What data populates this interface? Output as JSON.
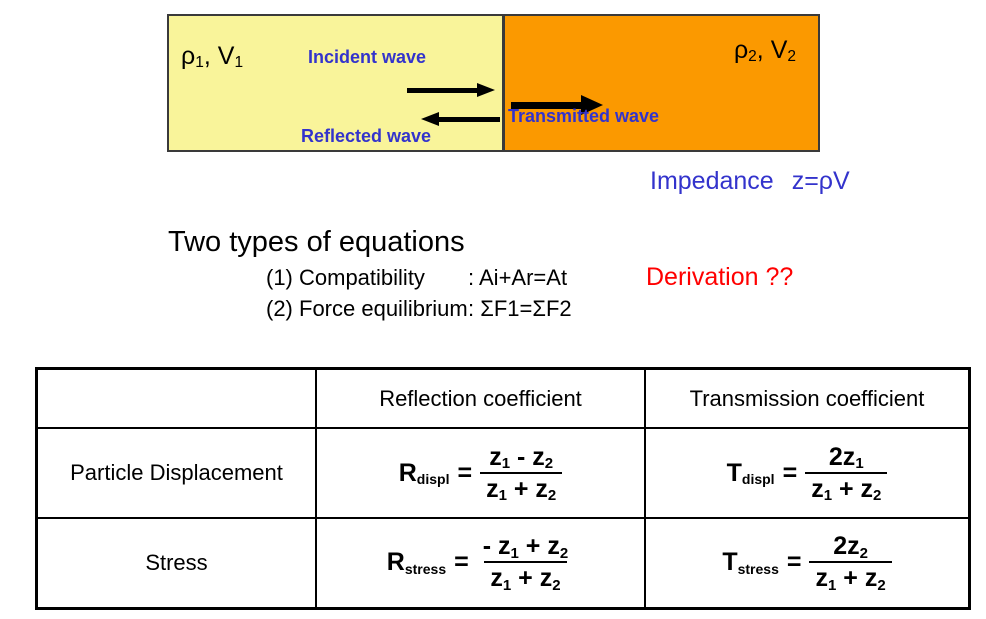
{
  "diagram": {
    "medium1": {
      "label_rho": "ρ",
      "label_rho_sub": "1",
      "label_v": ", V",
      "label_v_sub": "1",
      "fill_color": "#f9f49a"
    },
    "medium2": {
      "label_rho": "ρ",
      "label_rho_sub": "2",
      "label_v": ", V",
      "label_v_sub": "2",
      "fill_color": "#fb9900"
    },
    "incident_wave_label": "Incident wave",
    "reflected_wave_label": "Reflected wave",
    "transmitted_wave_label": "Transmitted  wave",
    "wave_label_color": "#3333cc",
    "arrow_color": "#000000"
  },
  "impedance": {
    "label": "Impedance",
    "formula": "z=ρV",
    "color": "#3333cc"
  },
  "equations": {
    "title": "Two types of equations",
    "items": [
      {
        "name": "(1) Compatibility",
        "expression": ": Ai+Ar=At"
      },
      {
        "name": "(2) Force equilibrium",
        "expression": ": ΣF1=ΣF2"
      }
    ],
    "note": "Derivation ??",
    "note_color": "#ff0000"
  },
  "table": {
    "headers": [
      "",
      "Reflection coefficient",
      "Transmission coefficient"
    ],
    "rows": [
      {
        "label": "Particle Displacement",
        "reflection": {
          "lhs": "R",
          "lhs_sub": "displ",
          "equals": "=",
          "numerator": "z₁ - z₂",
          "denominator": "z₁ + z₂",
          "num_parts": {
            "a": "z",
            "a_sub": "1",
            "op": " - ",
            "b": "z",
            "b_sub": "2"
          },
          "den_parts": {
            "a": "z",
            "a_sub": "1",
            "op": " + ",
            "b": "z",
            "b_sub": "2"
          }
        },
        "transmission": {
          "lhs": "T",
          "lhs_sub": "displ",
          "equals": "=",
          "numerator": "2z₁",
          "denominator": "z₁ + z₂",
          "num_parts": {
            "a": "2z",
            "a_sub": "1",
            "op": "",
            "b": "",
            "b_sub": ""
          },
          "den_parts": {
            "a": "z",
            "a_sub": "1",
            "op": " + ",
            "b": "z",
            "b_sub": "2"
          }
        }
      },
      {
        "label": "Stress",
        "reflection": {
          "lhs": "R",
          "lhs_sub": "stress",
          "equals": "=",
          "numerator": "- z₁ + z₂",
          "denominator": "z₁ + z₂",
          "num_parts": {
            "a": "- z",
            "a_sub": "1",
            "op": " + ",
            "b": "z",
            "b_sub": "2"
          },
          "den_parts": {
            "a": "z",
            "a_sub": "1",
            "op": " + ",
            "b": "z",
            "b_sub": "2"
          }
        },
        "transmission": {
          "lhs": "T",
          "lhs_sub": "stress",
          "equals": "=",
          "numerator": "2z₂",
          "denominator": "z₁ + z₂",
          "num_parts": {
            "a": "2z",
            "a_sub": "2",
            "op": "",
            "b": "",
            "b_sub": ""
          },
          "den_parts": {
            "a": "z",
            "a_sub": "1",
            "op": " + ",
            "b": "z",
            "b_sub": "2"
          }
        }
      }
    ]
  }
}
